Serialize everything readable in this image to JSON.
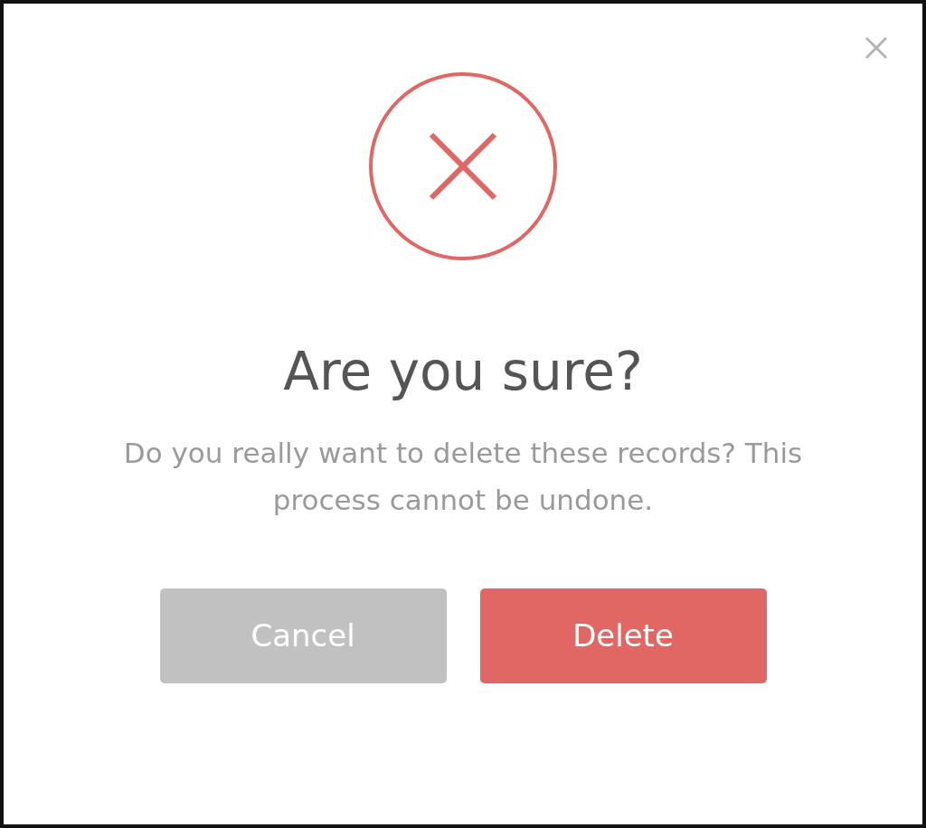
{
  "dialog": {
    "title": "Are you sure?",
    "message": "Do you really want to delete these records? This process cannot be undone.",
    "buttons": [
      {
        "label": "Cancel",
        "kind": "cancel"
      },
      {
        "label": "Delete",
        "kind": "delete"
      }
    ]
  }
}
